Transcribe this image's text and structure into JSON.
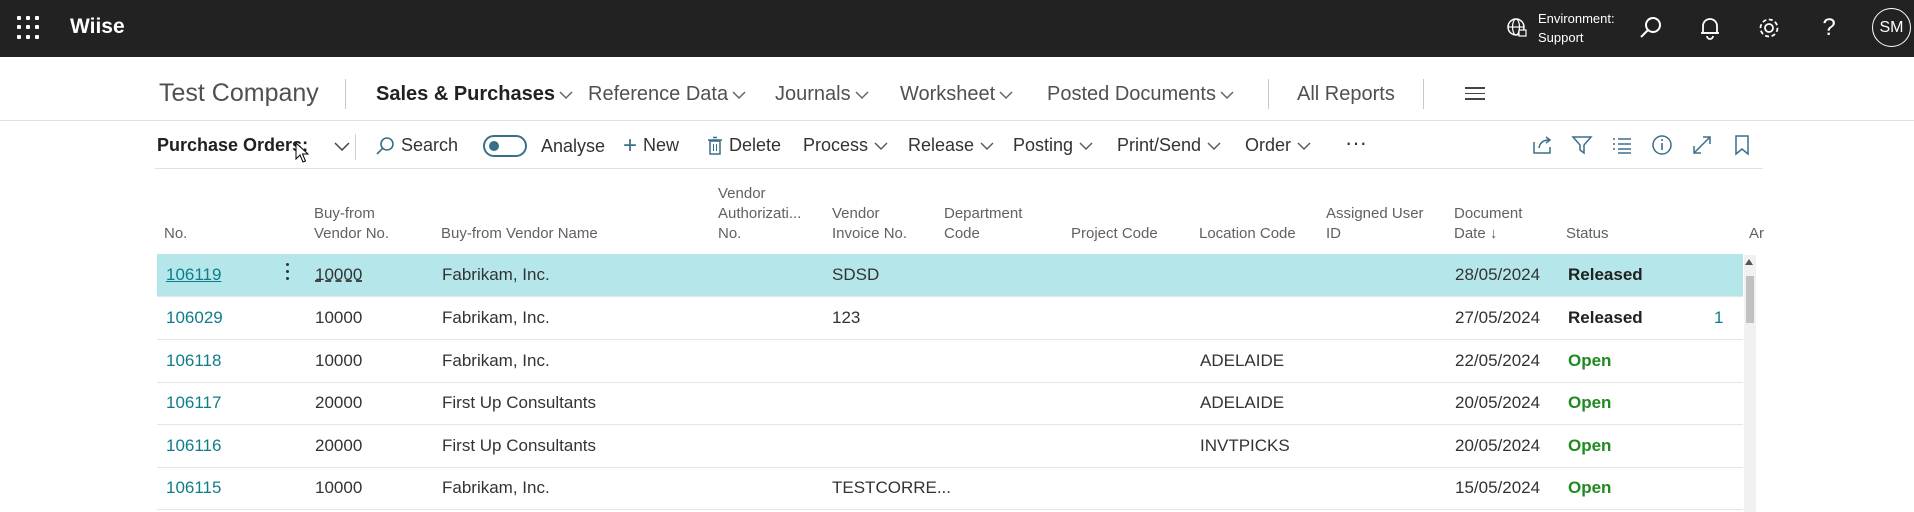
{
  "topbar": {
    "app_name": "Wiise",
    "environment_line1": "Environment:",
    "environment_line2": "Support",
    "user_initials": "SM"
  },
  "nav": {
    "company": "Test Company",
    "items": [
      "Sales & Purchases",
      "Reference Data",
      "Journals",
      "Worksheet",
      "Posted Documents"
    ],
    "all_reports": "All Reports"
  },
  "actions": {
    "title": "Purchase Orders:",
    "search": "Search",
    "analyse": "Analyse",
    "new": "New",
    "delete": "Delete",
    "process": "Process",
    "release": "Release",
    "posting": "Posting",
    "print_send": "Print/Send",
    "order": "Order",
    "more": "···"
  },
  "columns": {
    "no": "No.",
    "vendor_no_1": "Buy-from",
    "vendor_no_2": "Vendor No.",
    "vendor_name": "Buy-from Vendor Name",
    "auth_1": "Vendor",
    "auth_2": "Authorizati...",
    "auth_3": "No.",
    "inv_1": "Vendor",
    "inv_2": "Invoice No.",
    "dept_1": "Department",
    "dept_2": "Code",
    "project": "Project Code",
    "location": "Location Code",
    "user_1": "Assigned User",
    "user_2": "ID",
    "date_1": "Document",
    "date_2": "Date",
    "date_sort": "↓",
    "status": "Status",
    "cut": "Ar"
  },
  "rows": [
    {
      "no": "106119",
      "vendor_no": "10000",
      "vendor_name": "Fabrikam, Inc.",
      "invoice": "SDSD",
      "location": "",
      "date": "28/05/2024",
      "status": "Released",
      "extra": ""
    },
    {
      "no": "106029",
      "vendor_no": "10000",
      "vendor_name": "Fabrikam, Inc.",
      "invoice": "123",
      "location": "",
      "date": "27/05/2024",
      "status": "Released",
      "extra": "1"
    },
    {
      "no": "106118",
      "vendor_no": "10000",
      "vendor_name": "Fabrikam, Inc.",
      "invoice": "",
      "location": "ADELAIDE",
      "date": "22/05/2024",
      "status": "Open",
      "extra": ""
    },
    {
      "no": "106117",
      "vendor_no": "20000",
      "vendor_name": "First Up Consultants",
      "invoice": "",
      "location": "ADELAIDE",
      "date": "20/05/2024",
      "status": "Open",
      "extra": ""
    },
    {
      "no": "106116",
      "vendor_no": "20000",
      "vendor_name": "First Up Consultants",
      "invoice": "",
      "location": "INVTPICKS",
      "date": "20/05/2024",
      "status": "Open",
      "extra": ""
    },
    {
      "no": "106115",
      "vendor_no": "10000",
      "vendor_name": "Fabrikam, Inc.",
      "invoice": "TESTCORRE...",
      "location": "",
      "date": "15/05/2024",
      "status": "Open",
      "extra": ""
    }
  ],
  "colors": {
    "topbar": "#222222",
    "selected_row": "#b5e6ea",
    "link": "#0d7d8c",
    "open": "#1f8a20"
  }
}
